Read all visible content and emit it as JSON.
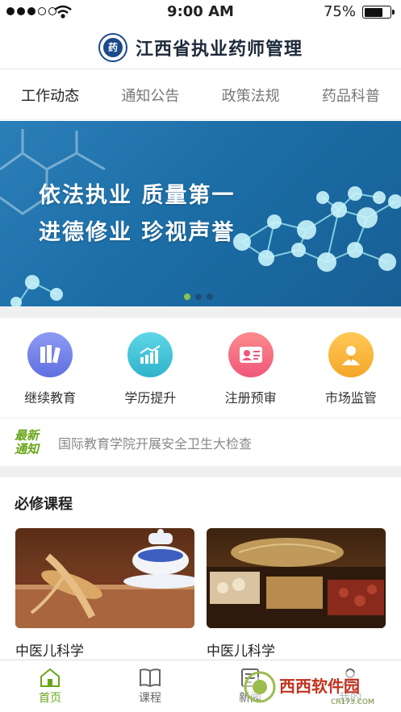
{
  "status_bar": {
    "time": "9:00 AM",
    "battery": "75%"
  },
  "header": {
    "title": "江西省执业药师管理",
    "logo_text": "药"
  },
  "tabs": [
    {
      "label": "工作动态",
      "active": true
    },
    {
      "label": "通知公告",
      "active": false
    },
    {
      "label": "政策法规",
      "active": false
    },
    {
      "label": "药品科普",
      "active": false
    }
  ],
  "banner": {
    "line1": "依法执业 质量第一",
    "line2": "进德修业 珍视声誉",
    "pages": 3,
    "current_page": 1
  },
  "quick_entries": [
    {
      "label": "继续教育",
      "icon": "books-icon",
      "color": "#6f7fe6"
    },
    {
      "label": "学历提升",
      "icon": "bar-chart-icon",
      "color": "#3cc0d6"
    },
    {
      "label": "注册预审",
      "icon": "id-card-icon",
      "color": "#f46a7e"
    },
    {
      "label": "市场监管",
      "icon": "officer-icon",
      "color": "#f6b02f"
    }
  ],
  "notice": {
    "badge_line1": "最新",
    "badge_line2": "通知",
    "text": "国际教育学院开展安全卫生大检查"
  },
  "required_courses": {
    "title": "必修课程",
    "courses": [
      {
        "title": "中医儿科学"
      },
      {
        "title": "中医儿科学"
      }
    ]
  },
  "bottom_nav": [
    {
      "label": "首页",
      "icon": "home-icon",
      "active": true
    },
    {
      "label": "课程",
      "icon": "book-icon",
      "active": false
    },
    {
      "label": "新闻",
      "icon": "news-icon",
      "active": false
    },
    {
      "label": "我的",
      "icon": "profile-icon",
      "active": false
    }
  ],
  "watermark": {
    "brand": "西西软件园",
    "url": "CR173.COM"
  },
  "colors": {
    "accent": "#6aa619",
    "banner": "#1c6ea7",
    "header_text": "#1d2a3a"
  }
}
